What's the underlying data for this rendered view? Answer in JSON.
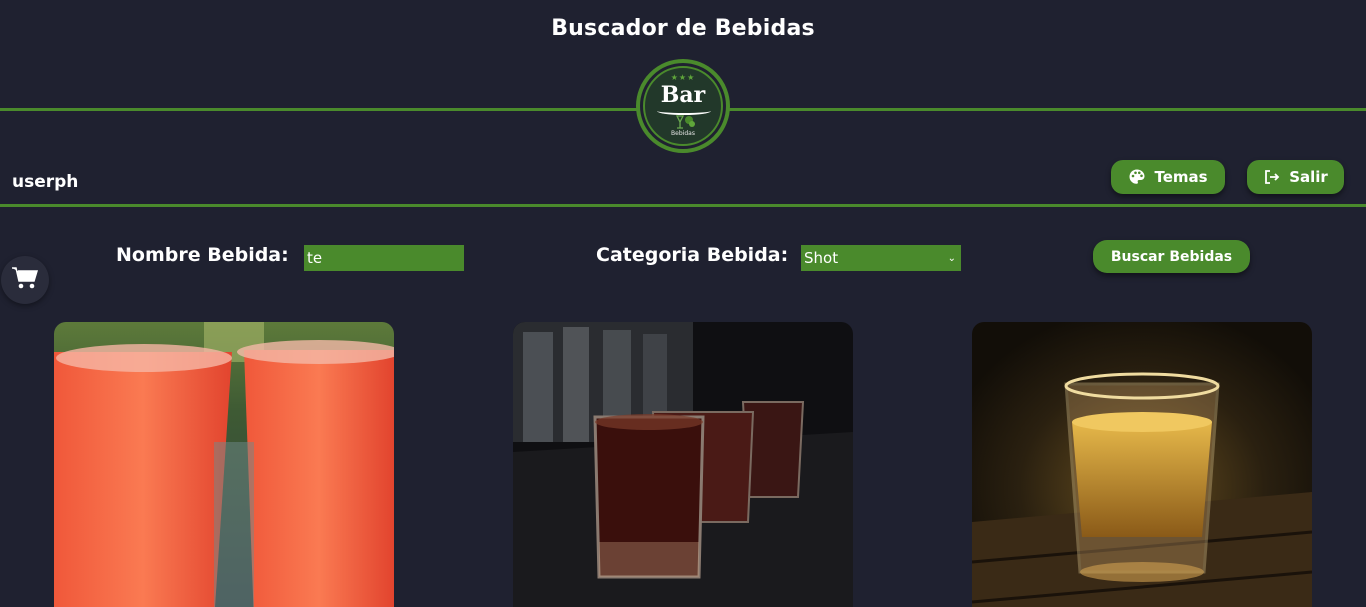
{
  "header": {
    "title": "Buscador de Bebidas",
    "logo_text": "Bar",
    "logo_subtext": "Bebidas"
  },
  "user": {
    "username": "userph"
  },
  "buttons": {
    "temas": {
      "label": "Temas",
      "icon": "palette-icon"
    },
    "salir": {
      "label": "Salir",
      "icon": "logout-icon"
    },
    "buscar": {
      "label": "Buscar Bebidas"
    }
  },
  "filters": {
    "nombre_label": "Nombre Bebida:",
    "nombre_value": "te",
    "categoria_label": "Categoria Bebida:",
    "categoria_value": "Shot"
  },
  "cart": {
    "icon": "cart-icon"
  },
  "drinks": [
    {
      "image": "red drinks in plastic cups"
    },
    {
      "image": "dark shot glasses on bar"
    },
    {
      "image": "amber shot glass on wood"
    }
  ],
  "colors": {
    "background": "#1f2130",
    "accent": "#4a8a2c"
  }
}
